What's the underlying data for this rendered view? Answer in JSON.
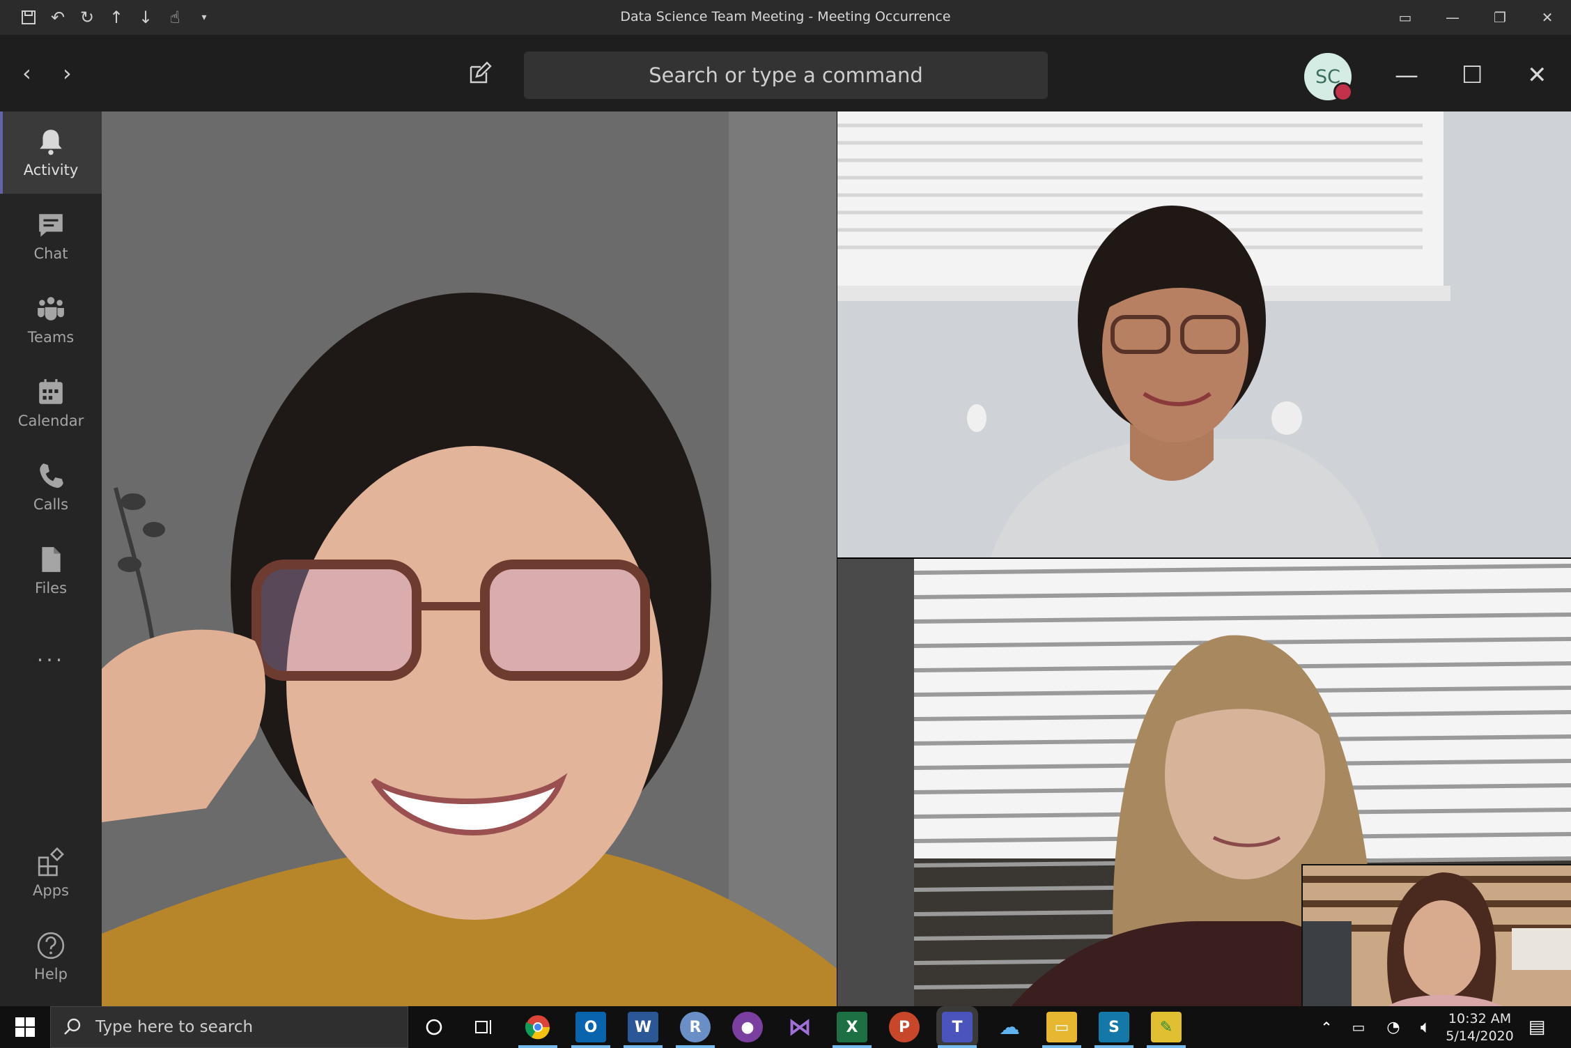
{
  "window": {
    "title": "Data Science Team Meeting  -  Meeting Occurrence"
  },
  "header": {
    "search_placeholder": "Search or type a command",
    "avatar_initials": "SC",
    "presence_color": "#c4314b"
  },
  "rail": {
    "items": [
      {
        "label": "Activity",
        "icon": "bell-icon"
      },
      {
        "label": "Chat",
        "icon": "chat-icon"
      },
      {
        "label": "Teams",
        "icon": "teams-icon"
      },
      {
        "label": "Calendar",
        "icon": "calendar-icon"
      },
      {
        "label": "Calls",
        "icon": "phone-icon"
      },
      {
        "label": "Files",
        "icon": "file-icon"
      }
    ],
    "more": "...",
    "apps_label": "Apps",
    "help_label": "Help",
    "accent": "#6264a7"
  },
  "taskbar": {
    "search_placeholder": "Type here to search",
    "apps": [
      "chrome-icon",
      "outlook-icon",
      "word-icon",
      "r-icon",
      "github-icon",
      "visual-studio-icon",
      "excel-icon",
      "powerpoint-icon",
      "teams-icon",
      "onedrive-icon",
      "file-explorer-icon",
      "sway-icon",
      "app-icon"
    ],
    "time": "10:32 AM",
    "date": "5/14/2020"
  }
}
